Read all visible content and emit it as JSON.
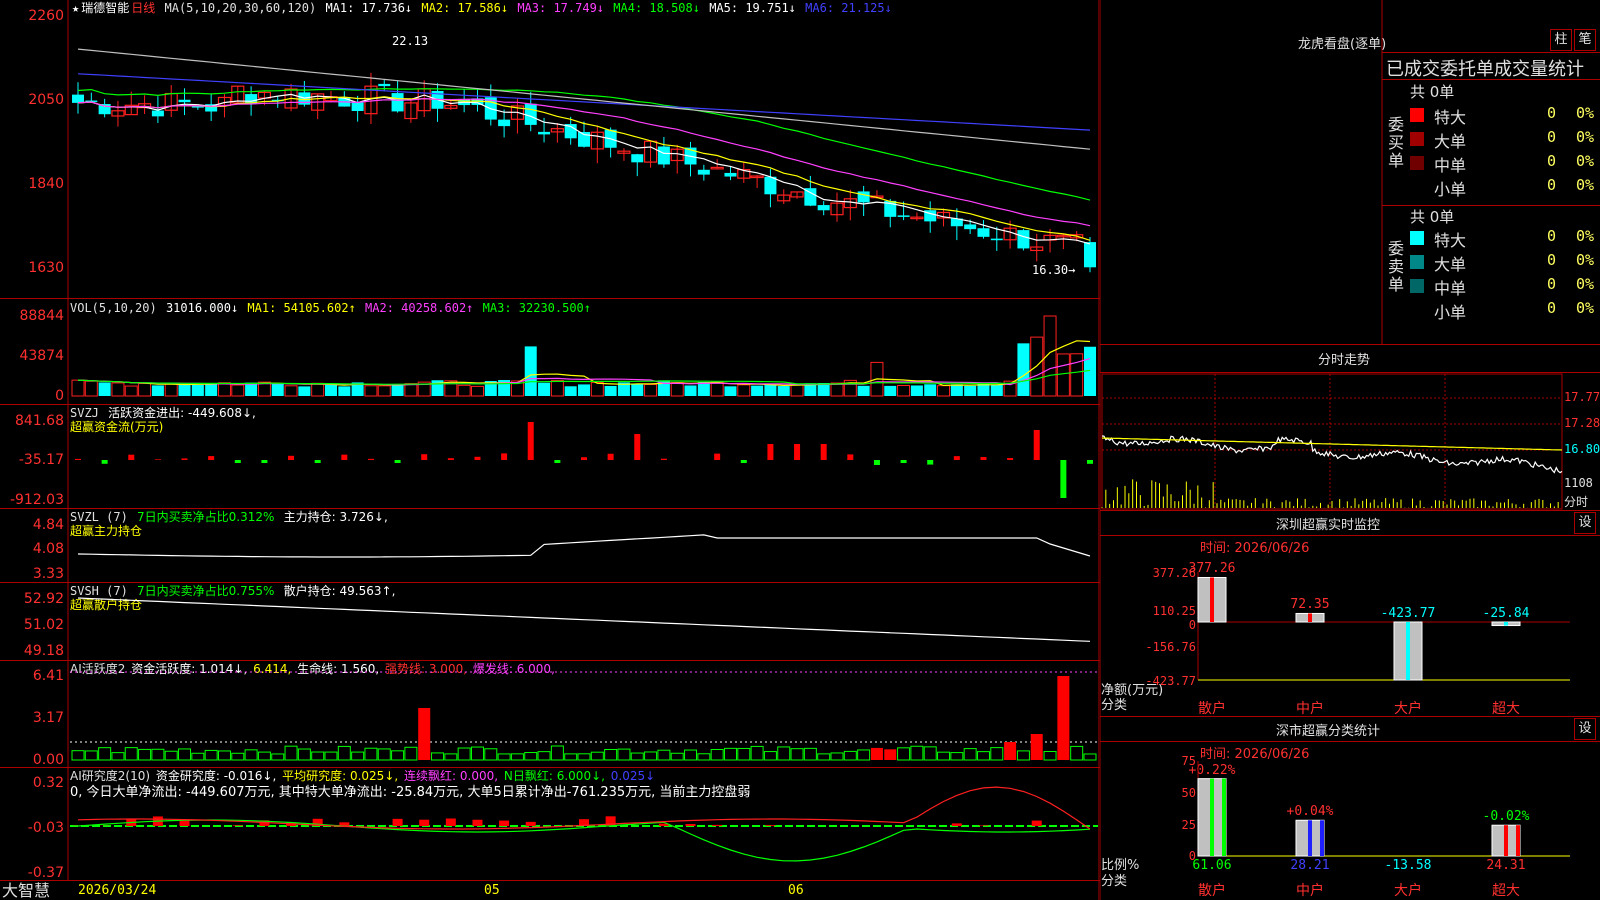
{
  "stock": {
    "star": "★",
    "name": "瑞德智能",
    "period": "日线",
    "brand": "大智慧"
  },
  "colors": {
    "up": "#ff2020",
    "down": "#00ffff",
    "ma1": "#ffffff",
    "ma2": "#ffff00",
    "ma3": "#ff40ff",
    "ma4": "#00ff00",
    "ma5": "#4040ff",
    "ma6": "#c0c0c0",
    "frame": "#aa0000",
    "axis_text": "#ff3030",
    "pos_bar": "#ff0000",
    "neg_bar": "#00ff00"
  },
  "price_panel": {
    "header": {
      "ma_def": "MA(5,10,20,30,60,120)",
      "ma1": "MA1: 17.736↓",
      "ma2": "MA2: 17.586↓",
      "ma3": "MA3: 17.749↓",
      "ma4": "MA4: 18.508↓",
      "ma5": "MA5: 19.751↓",
      "ma6": "MA6: 21.125↓"
    },
    "y_labels": [
      "2260",
      "2050",
      "1840",
      "1630"
    ],
    "high_label": "22.13",
    "low_label": "16.30→"
  },
  "vol_panel": {
    "header": {
      "def": "VOL(5,10,20)",
      "vol": "31016.000↓",
      "ma1": "MA1: 54105.602↑",
      "ma2": "MA2: 40258.602↑",
      "ma3": "MA3: 32230.500↑"
    },
    "y_labels": [
      "88844",
      "43874",
      "0"
    ]
  },
  "svzj_panel": {
    "header": {
      "name": "SVZJ",
      "label": "活跃资金进出: -449.608↓,",
      "sub": "超赢资金流(万元)"
    },
    "y_labels": [
      "841.68",
      "-35.17",
      "-912.03"
    ]
  },
  "svzl_panel": {
    "header": {
      "name": "SVZL (7)",
      "label1": "7日内买卖净占比0.312%",
      "label2": "主力持仓: 3.726↓,",
      "sub": "超赢主力持仓"
    },
    "y_labels": [
      "4.84",
      "4.08",
      "3.33"
    ]
  },
  "svsh_panel": {
    "header": {
      "name": "SVSH (7)",
      "label1": "7日内买卖净占比0.755%",
      "label2": "散户持仓: 49.563↑,",
      "sub": "超赢散户持仓"
    },
    "y_labels": [
      "52.92",
      "51.02",
      "49.18"
    ]
  },
  "active_panel": {
    "header": {
      "name": "AI活跃度2",
      "label1": "资金活跃度: 1.014↓,",
      "label2": "6.414,",
      "label3": "生命线: 1.560,",
      "label4": "强势线: 3.000,",
      "label5": "爆发线: 6.000,"
    },
    "y_labels": [
      "6.41",
      "3.17",
      "0.00"
    ]
  },
  "research_panel": {
    "header": {
      "name": "AI研究度2(10)",
      "label1": "资金研究度: -0.016↓,",
      "label2": "平均研究度: 0.025↓,",
      "label3": "连续飘红: 0.000,",
      "label4": "N日飘红: 6.000↓,",
      "label5": "0.025↓"
    },
    "summary": "0, 今日大单净流出: -449.607万元, 其中特大单净流出: -25.84万元, 大单5日累计净出-761.235万元, 当前主力控盘弱",
    "y_labels": [
      "0.32",
      "-0.03",
      "-0.37"
    ]
  },
  "date_axis": {
    "start": "2026/03/24",
    "m05": "05",
    "m06": "06"
  },
  "lhb": {
    "title": "龙虎看盘(逐单)",
    "btn1": "柱",
    "btn2": "笔",
    "subtitle": "已成交委托单成交量统计",
    "buy": {
      "label_chars": [
        "委",
        "买",
        "单"
      ],
      "total": "共 0单",
      "rows": [
        {
          "name": "特大",
          "color": "#ff0000",
          "val": "0",
          "pct": "0%"
        },
        {
          "name": "大单",
          "color": "#a00000",
          "val": "0",
          "pct": "0%"
        },
        {
          "name": "中单",
          "color": "#700000",
          "val": "0",
          "pct": "0%"
        },
        {
          "name": "小单",
          "color": "#000000",
          "val": "0",
          "pct": "0%"
        }
      ]
    },
    "sell": {
      "label_chars": [
        "委",
        "卖",
        "单"
      ],
      "total": "共 0单",
      "rows": [
        {
          "name": "特大",
          "color": "#00ffff",
          "val": "0",
          "pct": "0%"
        },
        {
          "name": "大单",
          "color": "#008888",
          "val": "0",
          "pct": "0%"
        },
        {
          "name": "中单",
          "color": "#006666",
          "val": "0",
          "pct": "0%"
        },
        {
          "name": "小单",
          "color": "#000000",
          "val": "0",
          "pct": "0%"
        }
      ]
    }
  },
  "intraday": {
    "title": "分时走势",
    "y_labels": [
      "17.77",
      "17.28",
      "16.80"
    ],
    "vol_label": "1108",
    "foot": "分时"
  },
  "sz_monitor": {
    "title": "深圳超赢实时监控",
    "set": "设",
    "time": "时间: 2026/06/26",
    "y_labels": [
      "377.26",
      "110.25",
      "0",
      "-156.76",
      "-423.77"
    ],
    "left_label1": "净额(万元)",
    "left_label2": "分类",
    "bars": [
      {
        "cat": "散户",
        "value": 377.26,
        "label": "377.26"
      },
      {
        "cat": "中户",
        "value": 72.35,
        "label": "72.35"
      },
      {
        "cat": "大户",
        "value": -423.77,
        "label": "-423.77"
      },
      {
        "cat": "超大",
        "value": -25.84,
        "label": "-25.84"
      }
    ]
  },
  "sz_class": {
    "title": "深市超赢分类统计",
    "set": "设",
    "time": "时间: 2026/06/26",
    "y_labels": [
      "75",
      "50",
      "25",
      "0"
    ],
    "left_label1": "比例%",
    "left_label2": "分类",
    "bars": [
      {
        "cat": "散户",
        "value": 61.06,
        "label": "61.06",
        "delta": "+0.22%"
      },
      {
        "cat": "中户",
        "value": 28.21,
        "label": "28.21",
        "delta": "+0.04%"
      },
      {
        "cat": "大户",
        "value": 0,
        "label": "-13.58",
        "delta": ""
      },
      {
        "cat": "超大",
        "value": 24.31,
        "label": "24.31",
        "delta": "-0.02%"
      }
    ]
  }
}
